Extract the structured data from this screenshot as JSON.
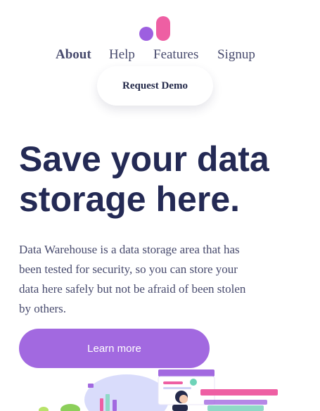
{
  "header": {
    "nav": [
      {
        "label": "About",
        "active": true
      },
      {
        "label": "Help",
        "active": false
      },
      {
        "label": "Features",
        "active": false
      },
      {
        "label": "Signup",
        "active": false
      }
    ],
    "request_demo_label": "Request Demo"
  },
  "hero": {
    "title_line1": "Save your data",
    "title_line2": "storage here.",
    "description": "Data Warehouse is a data storage area that has been tested for security, so you can store your data here safely but not be afraid of been stolen by others.",
    "cta_label": "Learn more"
  },
  "colors": {
    "brand_purple": "#a269e0",
    "brand_pink": "#ee5fa3",
    "heading": "#242a55",
    "text": "#474a6d"
  },
  "icons": {
    "logo": "logo-icon",
    "illustration": "hero-illustration"
  }
}
